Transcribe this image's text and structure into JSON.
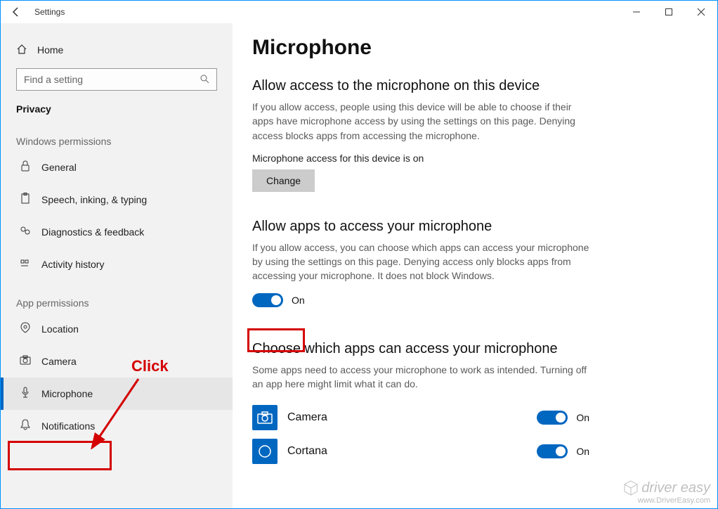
{
  "window": {
    "title": "Settings"
  },
  "sidebar": {
    "home": "Home",
    "search_placeholder": "Find a setting",
    "section": "Privacy",
    "group1": "Windows permissions",
    "group2": "App permissions",
    "items_win": [
      {
        "label": "General"
      },
      {
        "label": "Speech, inking, & typing"
      },
      {
        "label": "Diagnostics & feedback"
      },
      {
        "label": "Activity history"
      }
    ],
    "items_app": [
      {
        "label": "Location"
      },
      {
        "label": "Camera"
      },
      {
        "label": "Microphone"
      },
      {
        "label": "Notifications"
      }
    ]
  },
  "main": {
    "title": "Microphone",
    "s1_heading": "Allow access to the microphone on this device",
    "s1_desc": "If you allow access, people using this device will be able to choose if their apps have microphone access by using the settings on this page. Denying access blocks apps from accessing the microphone.",
    "s1_status": "Microphone access for this device is on",
    "s1_button": "Change",
    "s2_heading": "Allow apps to access your microphone",
    "s2_desc": "If you allow access, you can choose which apps can access your microphone by using the settings on this page. Denying access only blocks apps from accessing your microphone. It does not block Windows.",
    "s2_toggle_label": "On",
    "s3_heading": "Choose which apps can access your microphone",
    "s3_desc": "Some apps need to access your microphone to work as intended. Turning off an app here might limit what it can do.",
    "apps": [
      {
        "name": "Camera",
        "state": "On"
      },
      {
        "name": "Cortana",
        "state": "On"
      }
    ]
  },
  "annotation": {
    "click": "Click"
  },
  "watermark": {
    "brand": "driver easy",
    "url": "www.DriverEasy.com"
  }
}
